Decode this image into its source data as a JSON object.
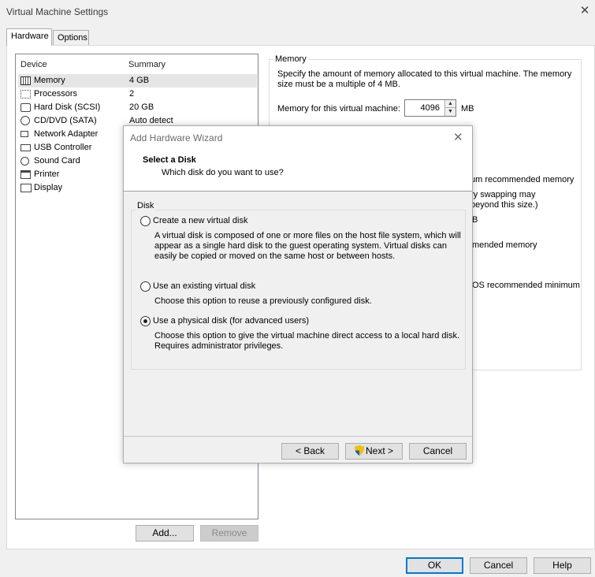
{
  "window": {
    "title": "Virtual Machine Settings",
    "close_icon": "close-icon"
  },
  "tabs": [
    {
      "label": "Hardware",
      "active": true
    },
    {
      "label": "Options",
      "active": false
    }
  ],
  "device_list": {
    "col_device": "Device",
    "col_summary": "Summary",
    "items": [
      {
        "name": "Memory",
        "summary": "4 GB",
        "icon": "memory-icon",
        "selected": true
      },
      {
        "name": "Processors",
        "summary": "2",
        "icon": "processor-icon"
      },
      {
        "name": "Hard Disk (SCSI)",
        "summary": "20 GB",
        "icon": "hard-disk-icon"
      },
      {
        "name": "CD/DVD (SATA)",
        "summary": "Auto detect",
        "icon": "cd-dvd-icon"
      },
      {
        "name": "Network Adapter",
        "summary": "",
        "icon": "network-adapter-icon"
      },
      {
        "name": "USB Controller",
        "summary": "",
        "icon": "usb-icon"
      },
      {
        "name": "Sound Card",
        "summary": "",
        "icon": "sound-card-icon"
      },
      {
        "name": "Printer",
        "summary": "",
        "icon": "printer-icon"
      },
      {
        "name": "Display",
        "summary": "",
        "icon": "display-icon"
      }
    ],
    "add_label": "Add...",
    "remove_label": "Remove"
  },
  "memory": {
    "group_title": "Memory",
    "desc_line1": "Specify the amount of memory allocated to this virtual machine. The memory",
    "desc_line2": "size must be a multiple of 4 MB.",
    "field_label": "Memory for this virtual machine:",
    "value": "4096",
    "unit": "MB",
    "partial_lines": [
      "um recommended memory",
      "ry swapping may",
      "beyond this size.)",
      "B",
      "mended memory",
      "OS recommended minimum"
    ]
  },
  "wizard": {
    "title": "Add Hardware Wizard",
    "heading": "Select a Disk",
    "subheading": "Which disk do you want to use?",
    "group_title": "Disk",
    "options": [
      {
        "label": "Create a new virtual disk",
        "selected": false,
        "desc": [
          "A virtual disk is composed of one or more files on the host file system, which will",
          "appear as a single hard disk to the guest operating system. Virtual disks can",
          "easily be copied or moved on the same host or between hosts."
        ]
      },
      {
        "label": "Use an existing virtual disk",
        "selected": false,
        "desc": [
          "Choose this option to reuse a previously configured disk."
        ]
      },
      {
        "label": "Use a physical disk (for advanced users)",
        "selected": true,
        "desc": [
          "Choose this option to give the virtual machine direct access to a local hard disk.",
          "Requires administrator privileges."
        ]
      }
    ],
    "back_label": "< Back",
    "next_label": "Next >",
    "cancel_label": "Cancel"
  },
  "footer": {
    "ok_label": "OK",
    "cancel_label": "Cancel",
    "help_label": "Help"
  },
  "colors": {
    "accent": "#0078d7",
    "selection": "#e5e5e5",
    "dialog_bg": "#f0f0f0"
  }
}
